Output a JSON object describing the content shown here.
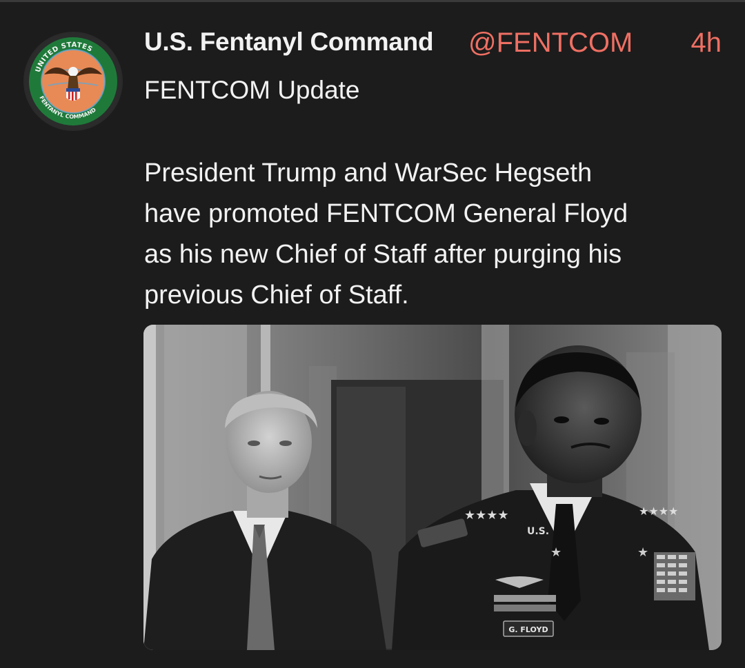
{
  "post": {
    "author": {
      "display_name": "U.S. Fentanyl Command",
      "handle": "@FENTCOM",
      "avatar_icon": "eagle-seal-icon",
      "avatar_ring_text_top": "UNITED STATES",
      "avatar_ring_text_bottom": "FENTANYL COMMAND"
    },
    "timestamp": "4h",
    "subtitle": "FENTCOM Update",
    "body_lines": [
      "President Trump and WarSec Hegseth",
      "have promoted FENTCOM General Floyd",
      "as his new Chief of Staff after purging his",
      "previous Chief of Staff."
    ],
    "media": {
      "type": "photo",
      "style": "black-and-white",
      "nameplate": "G. FLOYD",
      "collar_text": "U.S."
    }
  },
  "colors": {
    "background": "#1c1c1c",
    "accent": "#ef6f63",
    "text": "#f2f2f2"
  }
}
